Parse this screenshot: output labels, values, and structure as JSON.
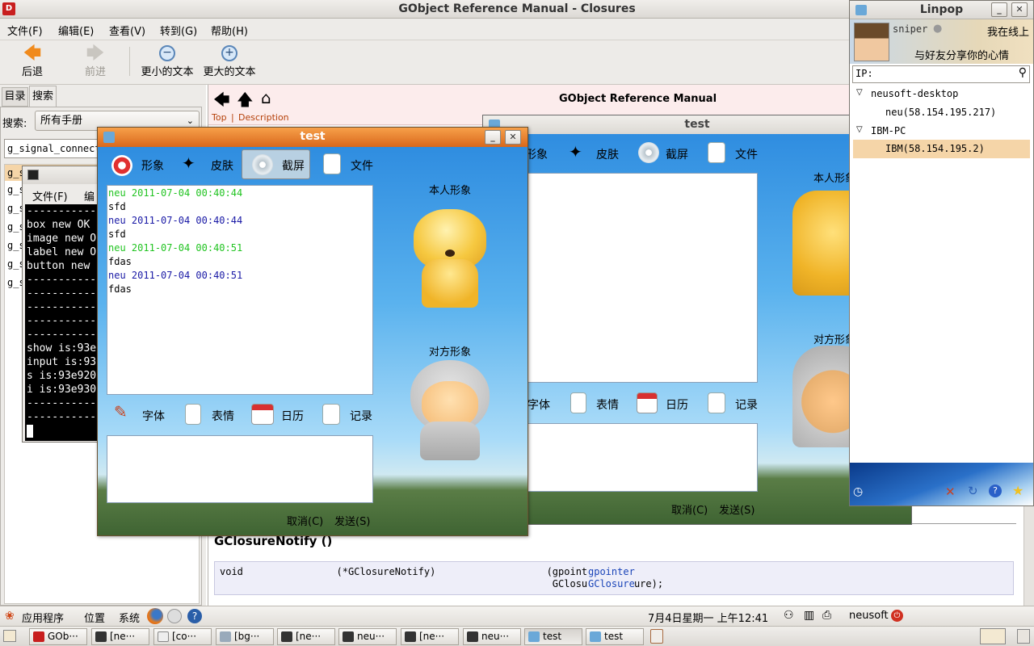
{
  "main_window": {
    "title": "GObject Reference Manual - Closures",
    "menu": [
      "文件(F)",
      "编辑(E)",
      "查看(V)",
      "转到(G)",
      "帮助(H)"
    ],
    "toolbar": {
      "back": "后退",
      "forward": "前进",
      "smaller": "更小的文本",
      "larger": "更大的文本"
    },
    "tabs": [
      "目录",
      "搜索"
    ],
    "search_label": "搜索:",
    "search_scope": "所有手册",
    "search_value": "g_signal_connect",
    "results": [
      "g_s",
      "g_s",
      "g_s",
      "g_s",
      "g_s",
      "g_s",
      "g_s"
    ],
    "doc": {
      "manual_title": "GObject Reference Manual",
      "links": [
        "Top",
        "|",
        "Description"
      ],
      "section_heading": "GClosureNotify ()",
      "code_line1": "void                (*GClosureNotify)                   (gpointer data,",
      "code_line2": "                                                         GClosure *closure);",
      "code_kw1": "gpointer",
      "code_kw2": "GClosure"
    }
  },
  "terminal": {
    "menu": [
      "文件(F)",
      "编"
    ],
    "lines": [
      "-----------",
      "box new OK",
      "image new O",
      "label new O",
      "button new",
      "-----------",
      "-----------",
      "-----------",
      "-----------",
      "-----------",
      "show is:93e",
      "input is:93",
      "s is:93e920",
      "i is:93e930",
      "-----------",
      "-----------"
    ]
  },
  "chat_front": {
    "title": "test",
    "toolbar": [
      "形象",
      "皮肤",
      "截屏",
      "文件"
    ],
    "messages": [
      {
        "name": "neu",
        "time": "2011-07-04 00:40:44",
        "text": "sfd",
        "color": "#22c422"
      },
      {
        "name": "neu",
        "time": "2011-07-04 00:40:44",
        "text": "sfd",
        "color": "#1a1aa6"
      },
      {
        "name": "neu",
        "time": "2011-07-04 00:40:51",
        "text": "fdas",
        "color": "#22c422"
      },
      {
        "name": "neu",
        "time": "2011-07-04 00:40:51",
        "text": "fdas",
        "color": "#1a1aa6"
      }
    ],
    "self_label": "本人形象",
    "peer_label": "对方形象",
    "bottom_tools": [
      "字体",
      "表情",
      "日历",
      "记录"
    ],
    "cancel": "取消(C)",
    "send": "发送(S)"
  },
  "chat_back": {
    "title": "test",
    "toolbar": [
      "形象",
      "皮肤",
      "截屏",
      "文件"
    ],
    "self_label": "本人形象",
    "peer_label": "对方形象",
    "bottom_tools": [
      "字体",
      "表情",
      "日历",
      "记录"
    ],
    "cancel": "取消(C)",
    "send": "发送(S)"
  },
  "linpop": {
    "title": "Linpop",
    "username": "sniper",
    "status": "我在线上",
    "motto": "与好友分享你的心情",
    "ip_label": "IP:",
    "groups": [
      {
        "name": "neusoft-desktop",
        "child": "neu(58.154.195.217)"
      },
      {
        "name": "IBM-PC",
        "child": "IBM(58.154.195.2)"
      }
    ]
  },
  "top_panel": {
    "menus": [
      "应用程序",
      "位置",
      "系统"
    ],
    "clock": "7月4日星期一 上午12:41",
    "user": "neusoft"
  },
  "taskbar": [
    "GOb···",
    "[ne···",
    "[co···",
    "[bg···",
    "[ne···",
    "neu···",
    "[ne···",
    "neu···",
    "test",
    "test"
  ],
  "colors": {
    "accent": "#e07a2a",
    "selection": "#f5d5a8",
    "link": "#b5410a"
  }
}
